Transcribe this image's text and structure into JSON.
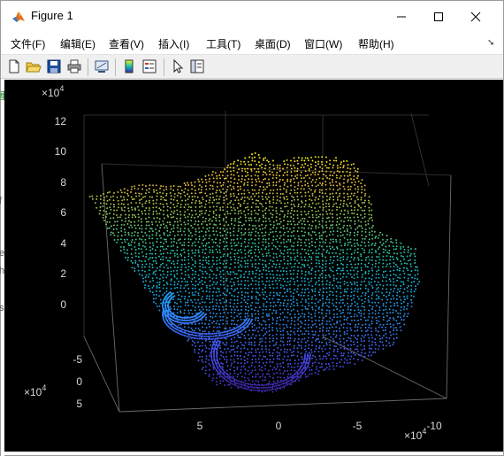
{
  "window": {
    "title": "Figure 1"
  },
  "menu": [
    {
      "label": "文件(F)"
    },
    {
      "label": "编辑(E)"
    },
    {
      "label": "查看(V)"
    },
    {
      "label": "插入(I)"
    },
    {
      "label": "工具(T)"
    },
    {
      "label": "桌面(D)"
    },
    {
      "label": "窗口(W)"
    },
    {
      "label": "帮助(H)"
    }
  ],
  "toolbar": {
    "buttons": [
      "new-figure-icon",
      "open-icon",
      "save-icon",
      "print-icon",
      "link-plot-icon",
      "insert-colorbar-icon",
      "insert-legend-icon",
      "edit-plot-arrow-icon",
      "property-inspector-icon"
    ]
  },
  "left_strip_chars": [
    "重",
    "f",
    "e",
    "h",
    "s"
  ],
  "chart_data": {
    "type": "scatter",
    "subtype": "3d-point-cloud",
    "colormap": "parula",
    "background": "#000000",
    "grid": true,
    "z_axis": {
      "ticks": [
        "0",
        "2",
        "4",
        "6",
        "8",
        "10",
        "12"
      ],
      "ticks_lower": [
        "-5",
        "0",
        "5"
      ],
      "exponent_label": "×10",
      "exponent_power": "4"
    },
    "y_axis": {
      "ticks": [
        "-5",
        "0",
        "5"
      ],
      "exponent_label": "×10",
      "exponent_power": "4"
    },
    "x_axis": {
      "ticks": [
        "5",
        "0",
        "-5",
        "-10"
      ],
      "exponent_label": "×10",
      "exponent_power": "4"
    }
  }
}
